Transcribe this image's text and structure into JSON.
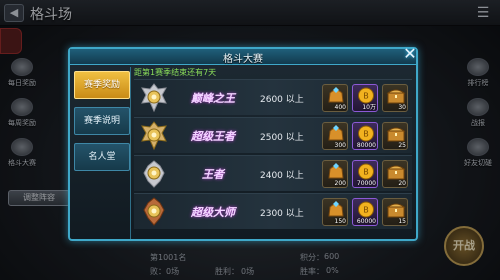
{
  "screen_title": "格斗场",
  "left_menu": [
    {
      "label": "每日奖励"
    },
    {
      "label": "每周奖励"
    },
    {
      "label": "格斗大赛"
    }
  ],
  "right_menu": [
    {
      "label": "排行榜"
    },
    {
      "label": "战报"
    },
    {
      "label": "好友切磋"
    }
  ],
  "bottom_button": "调整阵容",
  "status": {
    "rank": "第1001名",
    "score_label": "积分：",
    "score": "600",
    "fail_label": "败：",
    "fail": "0场",
    "win_label": "胜利：",
    "win": "0场",
    "rate_label": "胜率：",
    "rate": "0%"
  },
  "fight_button": "开战",
  "modal": {
    "title": "格斗大赛",
    "countdown": "距第1赛季结束还有7天",
    "tabs": [
      {
        "label": "赛季奖励",
        "active": true
      },
      {
        "label": "赛季说明",
        "active": false
      },
      {
        "label": "名人堂",
        "active": false
      }
    ],
    "tiers": [
      {
        "name": "巅峰之王",
        "score": "2600 以上",
        "rewards": [
          {
            "icon": "diamond-bag-icon",
            "qty": "400"
          },
          {
            "icon": "gold-coin-icon",
            "qty": "10万"
          },
          {
            "icon": "treasure-chest-icon",
            "qty": "30"
          }
        ]
      },
      {
        "name": "超级王者",
        "score": "2500 以上",
        "rewards": [
          {
            "icon": "diamond-bag-icon",
            "qty": "300"
          },
          {
            "icon": "gold-coin-icon",
            "qty": "80000"
          },
          {
            "icon": "treasure-chest-icon",
            "qty": "25"
          }
        ]
      },
      {
        "name": "王者",
        "score": "2400 以上",
        "rewards": [
          {
            "icon": "diamond-bag-icon",
            "qty": "200"
          },
          {
            "icon": "gold-coin-icon",
            "qty": "70000"
          },
          {
            "icon": "treasure-chest-icon",
            "qty": "20"
          }
        ]
      },
      {
        "name": "超级大师",
        "score": "2300 以上",
        "rewards": [
          {
            "icon": "diamond-bag-icon",
            "qty": "150"
          },
          {
            "icon": "gold-coin-icon",
            "qty": "60000"
          },
          {
            "icon": "treasure-chest-icon",
            "qty": "15"
          }
        ]
      }
    ]
  }
}
